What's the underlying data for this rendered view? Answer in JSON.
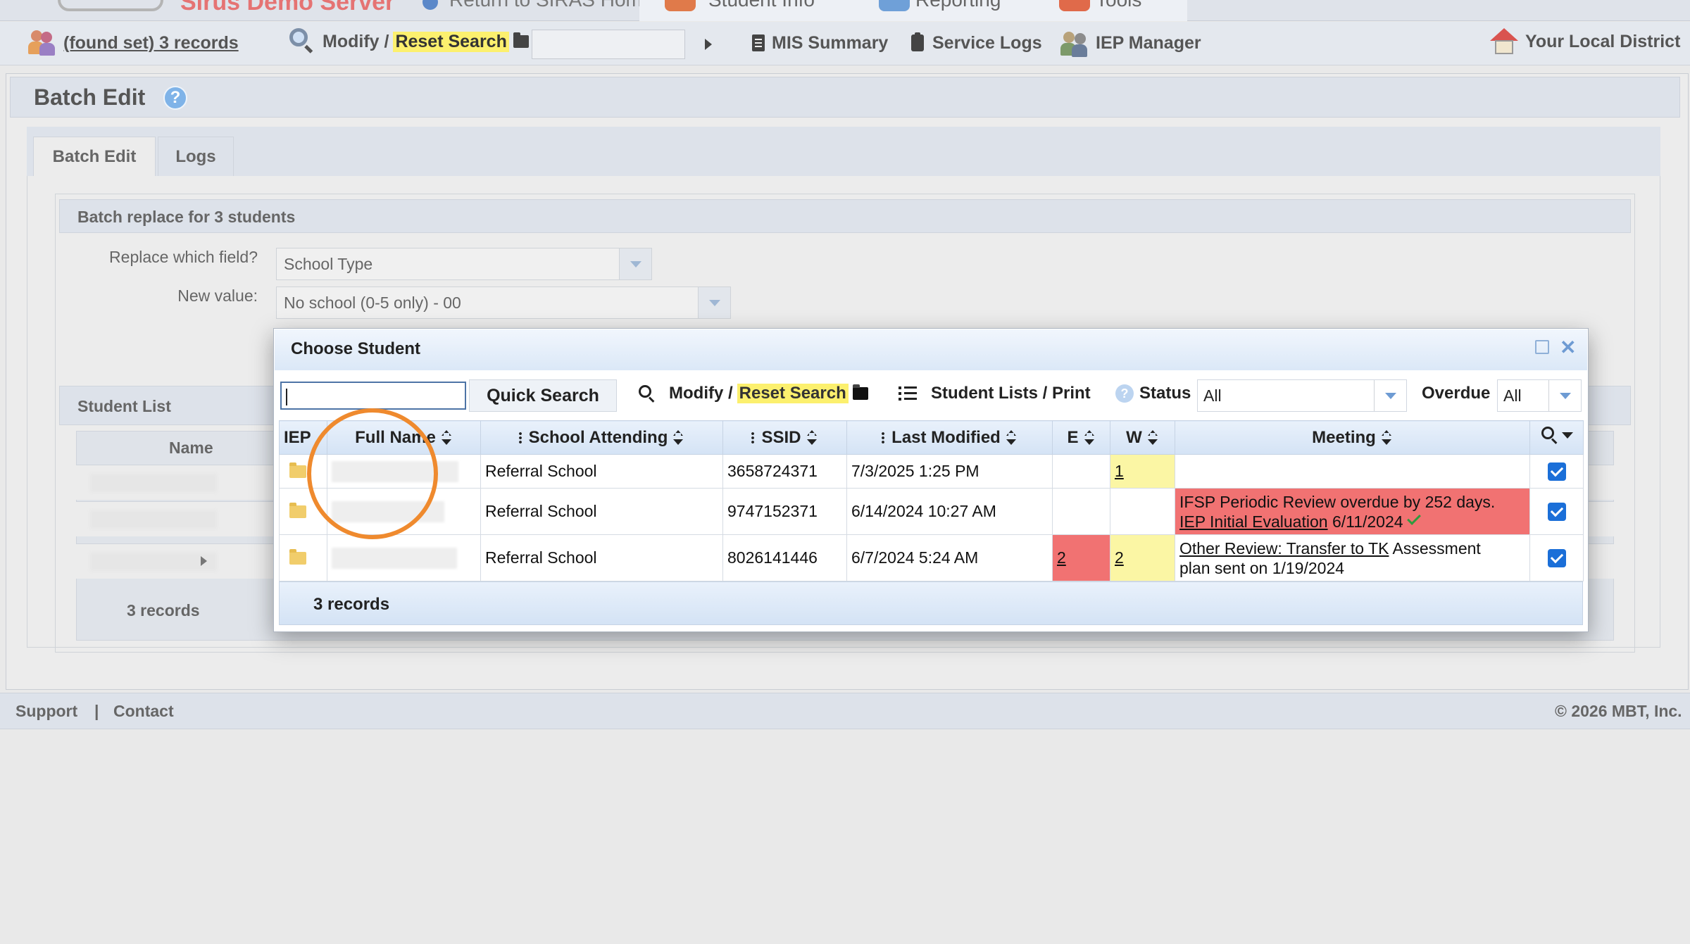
{
  "topnav": {
    "server_name": "Sirus Demo Server",
    "return_label": "Return to SIRAS Home",
    "tabs": [
      "Student Info",
      "Reporting",
      "Tools"
    ]
  },
  "toolbar": {
    "found_set": "(found set) 3 records",
    "modify": "Modify /",
    "reset": "Reset Search",
    "search_value": "",
    "mis_summary": "MIS Summary",
    "service_logs": "Service Logs",
    "iep_manager": "IEP Manager",
    "district": "Your Local District"
  },
  "page": {
    "title": "Batch Edit",
    "tabs": [
      "Batch Edit",
      "Logs"
    ],
    "batch_header": "Batch replace for 3 students",
    "replace_label": "Replace which field?",
    "replace_value": "School Type",
    "new_value_label": "New value:",
    "new_value": "No school (0-5 only) - 00",
    "student_list_header": "Student List",
    "student_list_name_col": "Name",
    "student_list_records": "3 records"
  },
  "modal": {
    "title": "Choose Student",
    "quick_search_value": "",
    "quick_search_button": "Quick Search",
    "modify": "Modify /",
    "reset": "Reset Search",
    "student_lists": "Student Lists / Print",
    "status_label": "Status",
    "status_value": "All",
    "overdue_label": "Overdue",
    "overdue_value": "All",
    "columns": {
      "iep": "IEP",
      "full_name": "Full Name",
      "school": "School Attending",
      "ssid": "SSID",
      "last_modified": "Last Modified",
      "e": "E",
      "w": "W",
      "meeting": "Meeting"
    },
    "rows": [
      {
        "school": "Referral School",
        "ssid": "3658724371",
        "last_modified": "7/3/2025 1:25 PM",
        "e": "",
        "w": "1",
        "meeting_line1": "",
        "meeting_link1": "",
        "meeting_line2": "",
        "meeting_link2": "",
        "meeting_date2": ""
      },
      {
        "school": "Referral School",
        "ssid": "9747152371",
        "last_modified": "6/14/2024 10:27 AM",
        "e": "",
        "w": "",
        "meeting_line1": "IFSP Periodic Review overdue by 252 days.",
        "meeting_link2": "IEP Initial Evaluation",
        "meeting_date2": "6/11/2024"
      },
      {
        "school": "Referral School",
        "ssid": "8026141446",
        "last_modified": "6/7/2024 5:24 AM",
        "e": "2",
        "w": "2",
        "meeting_link1": "Other Review: Transfer to TK",
        "meeting_text1": "Assessment",
        "meeting_line2": "plan sent on 1/19/2024"
      }
    ],
    "records": "3 records"
  },
  "footer": {
    "support": "Support",
    "separator": "|",
    "contact": "Contact",
    "copyright": "© 2026 MBT, Inc."
  },
  "colors": {
    "highlight": "#fcf06e",
    "overdue_red": "#f17272",
    "warn_yellow": "#fbf6a4",
    "focus_ring": "#ef8a2e",
    "checkbox_blue": "#1b6fd8"
  }
}
